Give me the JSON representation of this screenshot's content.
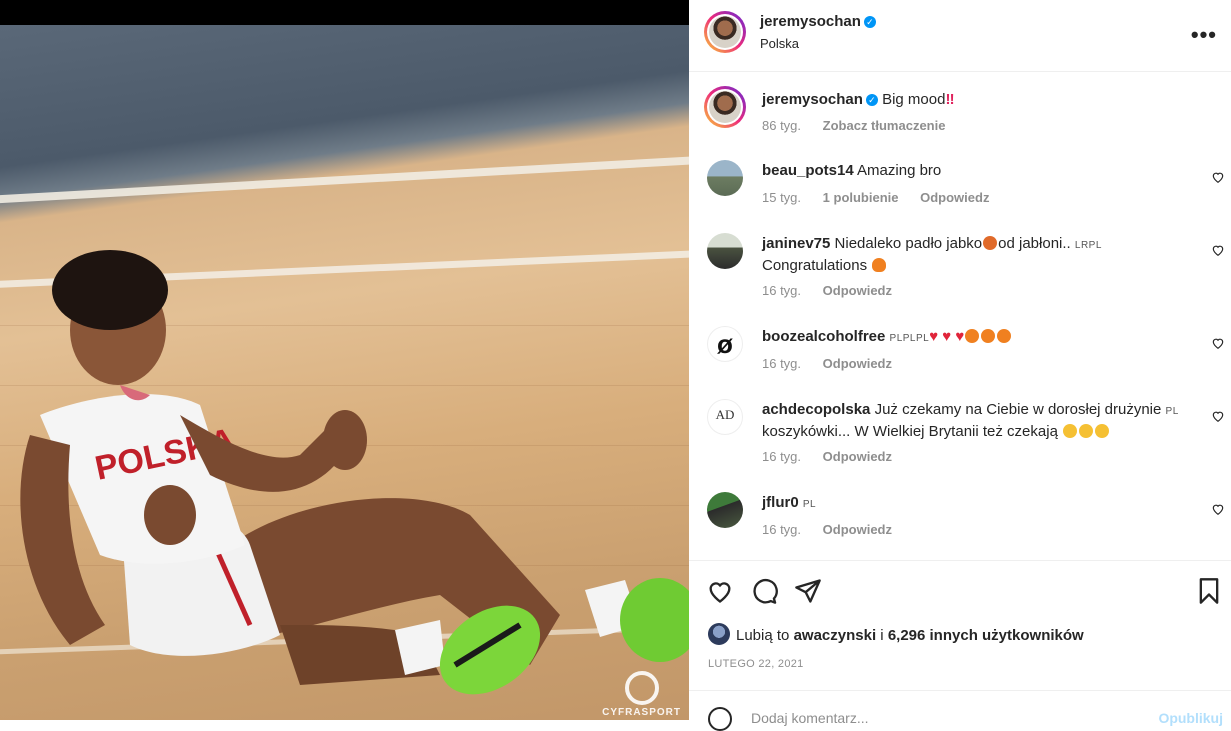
{
  "post": {
    "username": "jeremysochan",
    "location": "Polska",
    "more_label": "•••",
    "caption_text": "Big mood",
    "caption_time": "86 tyg.",
    "translate_label": "Zobacz tłumaczenie"
  },
  "media": {
    "watermark": "CYFRASPORT",
    "jersey_text": "POLSKA"
  },
  "comments": [
    {
      "username": "beau_pots14",
      "text": "Amazing bro",
      "tag": "",
      "time": "15 tyg.",
      "likes": "1 polubienie",
      "reply": "Odpowiedz"
    },
    {
      "username": "janinev75",
      "text": "Niedaleko padło jabko",
      "text2": "od jabłoni..",
      "tag": "LRPL",
      "line2": "Congratulations",
      "time": "16 tyg.",
      "reply": "Odpowiedz"
    },
    {
      "username": "boozealcoholfree",
      "text": "",
      "tag": "PLPLPL",
      "time": "16 tyg.",
      "reply": "Odpowiedz"
    },
    {
      "username": "achdecopolska",
      "text": "Już czekamy na Ciebie w dorosłej drużynie",
      "tag": "PL",
      "line2": "koszykówki... W Wielkiej Brytanii też czekają",
      "time": "16 tyg.",
      "reply": "Odpowiedz"
    },
    {
      "username": "jflur0",
      "text": "",
      "tag": "PL",
      "time": "16 tyg.",
      "reply": "Odpowiedz"
    }
  ],
  "likes": {
    "prefix": "Lubią to",
    "user": "awaczynski",
    "joiner": "i",
    "count": "6,296 innych użytkowników"
  },
  "date": "LUTEGO 22, 2021",
  "comment_box": {
    "placeholder": "Dodaj komentarz...",
    "post_label": "Opublikuj"
  },
  "colors": {
    "accent": "#0095f6",
    "heart_red": "#ed4956",
    "muted": "#8e8e8e"
  }
}
